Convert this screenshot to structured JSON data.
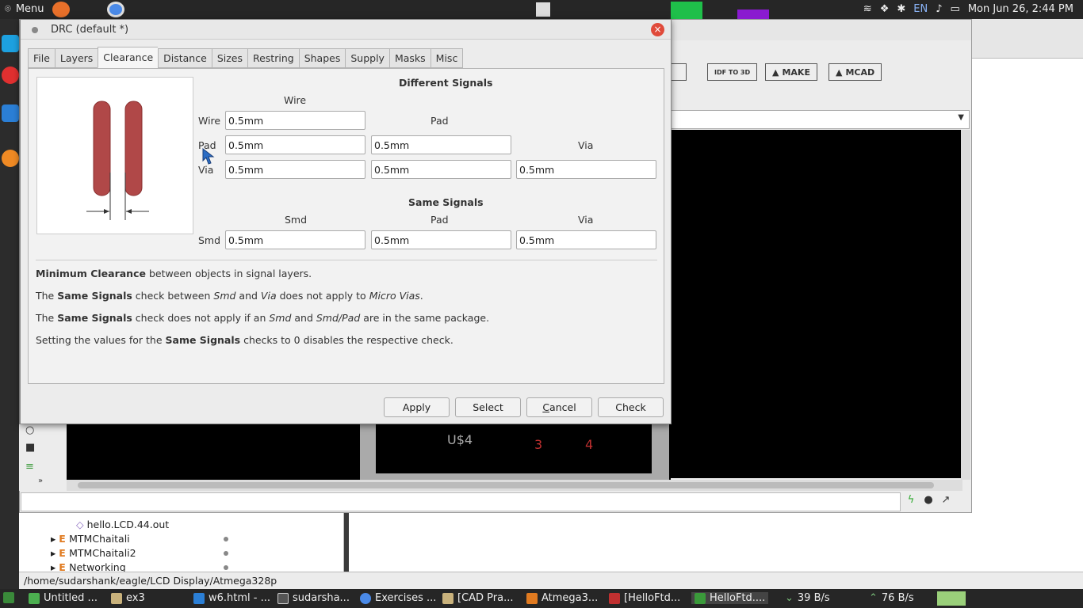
{
  "topbar": {
    "menu_label": "Menu",
    "keyboard_layout": "EN",
    "datetime": "Mon Jun 26,  2:44 PM"
  },
  "background": {
    "toolbar_buttons": [
      "IDF TO 3D",
      "MAKE",
      "MCAD"
    ],
    "board_labels": {
      "part": "U$4",
      "pin_left": "3",
      "pin_right": "4"
    },
    "file_tree": {
      "file": "hello.LCD.44.out",
      "folders": [
        "MTMChaitali",
        "MTMChaitali2",
        "Networking"
      ]
    },
    "path": "/home/sudarshank/eagle/LCD Display/Atmega328p"
  },
  "taskbar": {
    "items": [
      "Untitled ...",
      "ex3",
      "w6.html - ...",
      "sudarsha...",
      "Exercises ...",
      "[CAD Pra...",
      "Atmega3...",
      "[HelloFtd...",
      "HelloFtd...."
    ],
    "net_down": "39 B/s",
    "net_up": "76 B/s"
  },
  "dialog": {
    "title": "DRC (default *)",
    "tabs": [
      "File",
      "Layers",
      "Clearance",
      "Distance",
      "Sizes",
      "Restring",
      "Shapes",
      "Supply",
      "Masks",
      "Misc"
    ],
    "active_tab": "Clearance",
    "different_signals": {
      "heading": "Different Signals",
      "col_wire": "Wire",
      "col_pad": "Pad",
      "col_via": "Via",
      "row_wire": "Wire",
      "row_pad": "Pad",
      "row_via": "Via",
      "wire_wire": "0.5mm",
      "pad_wire": "0.5mm",
      "pad_pad": "0.5mm",
      "via_wire": "0.5mm",
      "via_pad": "0.5mm",
      "via_via": "0.5mm"
    },
    "same_signals": {
      "heading": "Same Signals",
      "col_smd": "Smd",
      "col_pad": "Pad",
      "col_via": "Via",
      "row_smd": "Smd",
      "smd_smd": "0.5mm",
      "smd_pad": "0.5mm",
      "smd_via": "0.5mm"
    },
    "notes": {
      "n1_b": "Minimum Clearance",
      "n1_t": " between objects in signal layers.",
      "n2_a": "The ",
      "n2_b": "Same Signals",
      "n2_c": " check between ",
      "n2_i1": "Smd",
      "n2_d": " and ",
      "n2_i2": "Via",
      "n2_e": " does not apply to ",
      "n2_i3": "Micro Vias",
      "n2_f": ".",
      "n3_a": "The ",
      "n3_b": "Same Signals",
      "n3_c": " check does not apply if an ",
      "n3_i1": "Smd",
      "n3_d": " and ",
      "n3_i2": "Smd/Pad",
      "n3_e": " are in the same package.",
      "n4_a": "Setting the values for the ",
      "n4_b": "Same Signals",
      "n4_c": " checks to 0 disables the respective check."
    },
    "buttons": {
      "apply": "Apply",
      "select": "Select",
      "cancel_pre": "",
      "cancel_u": "C",
      "cancel_post": "ancel",
      "check": "Check"
    }
  }
}
